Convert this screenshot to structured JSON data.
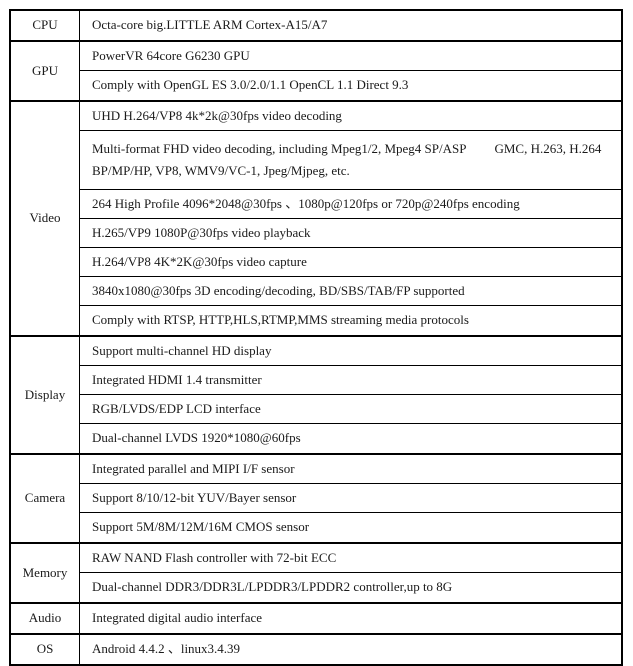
{
  "table": {
    "sections": [
      {
        "label": "CPU",
        "rows": [
          {
            "lines": [
              "Octa-core big.LITTLE ARM Cortex-A15/A7"
            ]
          }
        ]
      },
      {
        "label": "GPU",
        "rows": [
          {
            "lines": [
              "PowerVR 64core G6230 GPU"
            ]
          },
          {
            "lines": [
              "Comply with OpenGL ES 3.0/2.0/1.1 OpenCL 1.1 Direct 9.3"
            ]
          }
        ]
      },
      {
        "label": "Video",
        "rows": [
          {
            "lines": [
              "UHD H.264/VP8 4k*2k@30fps video decoding"
            ]
          },
          {
            "lines": [
              "Multi-format FHD video decoding, including Mpeg1/2, Mpeg4 SP/ASP",
              "GMC, H.263, H.264",
              "BP/MP/HP, VP8, WMV9/VC-1, Jpeg/Mjpeg, etc."
            ],
            "split_line": true
          },
          {
            "lines": [
              "264 High Profile 4096*2048@30fps 、1080p@120fps or 720p@240fps encoding"
            ]
          },
          {
            "lines": [
              "H.265/VP9 1080P@30fps video playback"
            ]
          },
          {
            "lines": [
              "H.264/VP8 4K*2K@30fps video capture"
            ]
          },
          {
            "lines": [
              "3840x1080@30fps 3D encoding/decoding, BD/SBS/TAB/FP supported"
            ]
          },
          {
            "lines": [
              "Comply with RTSP, HTTP,HLS,RTMP,MMS streaming media protocols"
            ]
          }
        ]
      },
      {
        "label": "Display",
        "rows": [
          {
            "lines": [
              "Support multi-channel HD display"
            ]
          },
          {
            "lines": [
              "Integrated HDMI 1.4 transmitter"
            ]
          },
          {
            "lines": [
              "RGB/LVDS/EDP LCD interface"
            ]
          },
          {
            "lines": [
              "Dual-channel LVDS 1920*1080@60fps"
            ]
          }
        ]
      },
      {
        "label": "Camera",
        "rows": [
          {
            "lines": [
              "Integrated parallel and MIPI I/F sensor"
            ]
          },
          {
            "lines": [
              "Support 8/10/12-bit YUV/Bayer sensor"
            ]
          },
          {
            "lines": [
              "Support 5M/8M/12M/16M CMOS sensor"
            ]
          }
        ]
      },
      {
        "label": "Memory",
        "rows": [
          {
            "lines": [
              "RAW NAND Flash controller with 72-bit ECC"
            ]
          },
          {
            "lines": [
              "Dual-channel DDR3/DDR3L/LPDDR3/LPDDR2 controller,up to 8G"
            ]
          }
        ]
      },
      {
        "label": "Audio",
        "rows": [
          {
            "lines": [
              "Integrated digital audio interface"
            ]
          }
        ]
      },
      {
        "label": "OS",
        "rows": [
          {
            "lines": [
              "Android 4.4.2 、linux3.4.39"
            ]
          }
        ]
      }
    ]
  }
}
